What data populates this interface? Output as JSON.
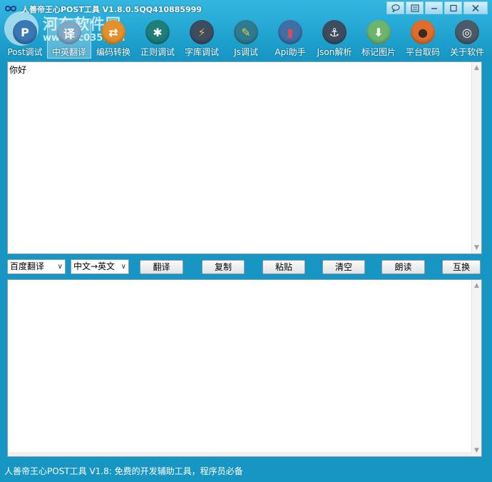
{
  "window": {
    "title": "人善帝王心POST工具 V1.8.0.5QQ410885999",
    "watermark_text": "河东软件园",
    "watermark_url": "www.pc0359.cn"
  },
  "sysbuttons": [
    {
      "name": "chat-bubble",
      "glyph": "◌"
    },
    {
      "name": "menu",
      "glyph": "▤"
    },
    {
      "name": "minimize",
      "glyph": "—"
    },
    {
      "name": "maximize",
      "glyph": "□"
    },
    {
      "name": "close",
      "glyph": "✕"
    }
  ],
  "toolbar": {
    "items": [
      {
        "label": "Post调试",
        "icon": "post-icon",
        "color": "#3a77b5",
        "glyph": "P"
      },
      {
        "label": "中英翻译",
        "icon": "translate-icon",
        "color": "#7fa8c7",
        "glyph": "译"
      },
      {
        "label": "编码转换",
        "icon": "encode-icon",
        "color": "#e3912b",
        "glyph": "⇄"
      },
      {
        "label": "正则调试",
        "icon": "regex-icon",
        "color": "#1e7e7a",
        "glyph": "✱"
      },
      {
        "label": "字库调试",
        "icon": "font-lib-icon",
        "color": "#3d4d60",
        "glyph": "⚡"
      },
      {
        "label": "Js调试",
        "icon": "js-icon",
        "color": "#2f7b8e",
        "glyph": "✎"
      },
      {
        "label": "Api助手",
        "icon": "api-icon",
        "color": "#3e6fa6",
        "glyph": "▮"
      },
      {
        "label": "Json解析",
        "icon": "json-icon",
        "color": "#3d4d60",
        "glyph": "⚓"
      },
      {
        "label": "标记图片",
        "icon": "mark-image-icon",
        "color": "#6db46d",
        "glyph": "⬇"
      },
      {
        "label": "平台取码",
        "icon": "platform-icon",
        "color": "#e06d2c",
        "glyph": "●"
      },
      {
        "label": "关于软件",
        "icon": "about-icon",
        "color": "#4c5a68",
        "glyph": "◎"
      }
    ],
    "active_index": 1
  },
  "input": {
    "text": "你好"
  },
  "controls": {
    "engine_select": "百度翻译",
    "direction_select": "中文→英文",
    "buttons": {
      "translate": "翻译",
      "copy": "复制",
      "paste": "粘贴",
      "clear": "清空",
      "read": "朗读",
      "swap": "互换"
    }
  },
  "output": {
    "text": ""
  },
  "status": {
    "text": "人善帝王心POST工具 V1.8: 免费的开发辅助工具，程序员必备"
  }
}
